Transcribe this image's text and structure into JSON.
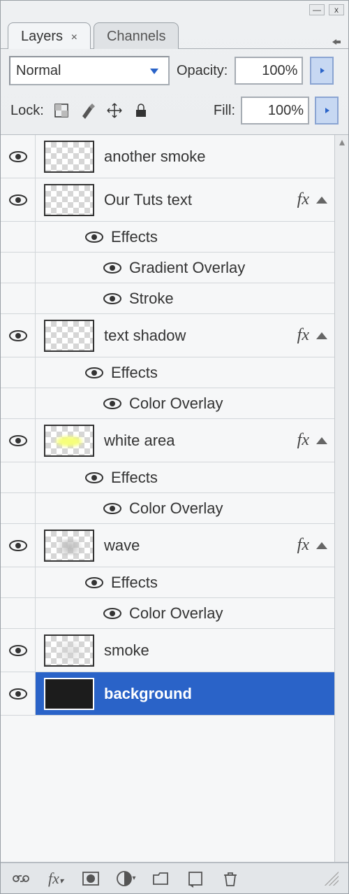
{
  "tabs": {
    "layers": "Layers",
    "channels": "Channels"
  },
  "blend": {
    "mode": "Normal"
  },
  "opacity": {
    "label": "Opacity:",
    "value": "100%"
  },
  "fill": {
    "label": "Fill:",
    "value": "100%"
  },
  "lock": {
    "label": "Lock:"
  },
  "effects_label": "Effects",
  "fx_label": "fx",
  "fx_items": {
    "gradient_overlay": "Gradient Overlay",
    "stroke": "Stroke",
    "color_overlay": "Color Overlay"
  },
  "layers": [
    {
      "name": "another smoke",
      "thumb": "checker",
      "fx": false,
      "selected": false,
      "effects": []
    },
    {
      "name": "Our Tuts text",
      "thumb": "checker",
      "fx": true,
      "selected": false,
      "effects": [
        "gradient_overlay",
        "stroke"
      ]
    },
    {
      "name": "text shadow",
      "thumb": "checker",
      "fx": true,
      "selected": false,
      "effects": [
        "color_overlay"
      ]
    },
    {
      "name": "white area",
      "thumb": "yellow",
      "fx": true,
      "selected": false,
      "effects": [
        "color_overlay"
      ]
    },
    {
      "name": "wave",
      "thumb": "gray",
      "fx": true,
      "selected": false,
      "effects": [
        "color_overlay"
      ]
    },
    {
      "name": "smoke",
      "thumb": "smoke",
      "fx": false,
      "selected": false,
      "effects": []
    },
    {
      "name": "background",
      "thumb": "dark",
      "fx": false,
      "selected": true,
      "effects": []
    }
  ],
  "titlebar": {
    "min": "—",
    "close": "x"
  }
}
